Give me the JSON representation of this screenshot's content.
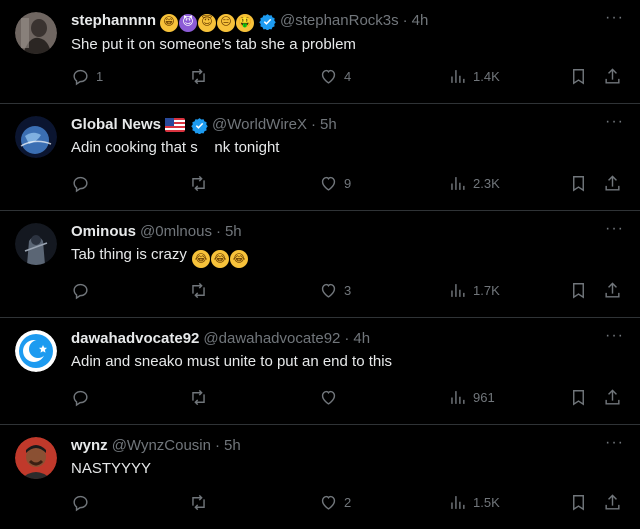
{
  "tweets": [
    {
      "name": "stephannnn",
      "handle": "@stephanRock3s",
      "dot": "·",
      "time": "4h",
      "text": "She put it on someone’s tab she a problem",
      "reply_count": "1",
      "retweet_count": "",
      "like_count": "4",
      "view_count": "1.4K",
      "more_label": "···",
      "avatar_colors": [
        "#8a7f78",
        "#3a3330"
      ]
    },
    {
      "name": "Global News",
      "handle": "@WorldWireX",
      "dot": "·",
      "time": "5h",
      "text": "Adin cooking that s    nk tonight",
      "reply_count": "",
      "retweet_count": "",
      "like_count": "9",
      "view_count": "2.3K",
      "more_label": "···",
      "avatar_colors": [
        "#3b6fb3",
        "#0b1530"
      ]
    },
    {
      "name": "Ominous",
      "handle": "@0mlnous",
      "dot": "·",
      "time": "5h",
      "text": "Tab thing is crazy",
      "reply_count": "",
      "retweet_count": "",
      "like_count": "3",
      "view_count": "1.7K",
      "more_label": "···",
      "avatar_colors": [
        "#5b6675",
        "#141820"
      ]
    },
    {
      "name": "dawahadvocate92",
      "handle": "@dawahadvocate92",
      "dot": "·",
      "time": "4h",
      "text": "Adin and sneako must unite to put an end to this",
      "reply_count": "",
      "retweet_count": "",
      "like_count": "",
      "view_count": "961",
      "more_label": "···",
      "avatar_colors": [
        "#1d9bf0",
        "#ffffff"
      ]
    },
    {
      "name": "wynz",
      "handle": "@WynzCousin",
      "dot": "·",
      "time": "5h",
      "text": "NASTYYYY",
      "reply_count": "",
      "retweet_count": "",
      "like_count": "2",
      "view_count": "1.5K",
      "more_label": "···",
      "avatar_colors": [
        "#c0392b",
        "#6b3a22"
      ]
    }
  ],
  "colors": {
    "background": "#000000",
    "text": "#e7e9ea",
    "secondary": "#71767b",
    "divider": "#2f3336",
    "verified": "#1d9bf0"
  }
}
